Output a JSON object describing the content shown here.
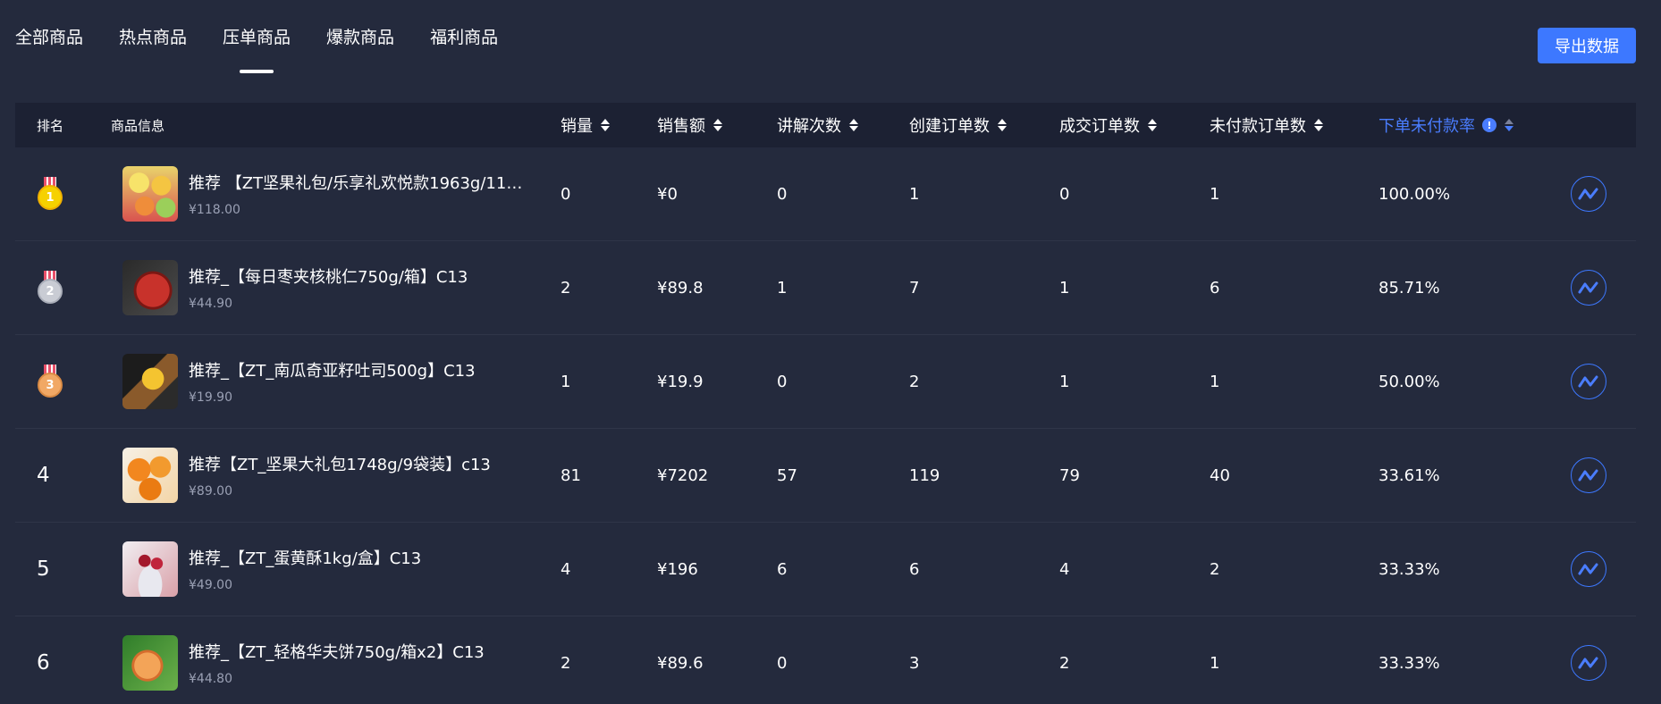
{
  "tabs": [
    {
      "label": "全部商品",
      "active": false
    },
    {
      "label": "热点商品",
      "active": false
    },
    {
      "label": "压单商品",
      "active": true
    },
    {
      "label": "爆款商品",
      "active": false
    },
    {
      "label": "福利商品",
      "active": false
    }
  ],
  "export_button": "导出数据",
  "columns": {
    "rank": "排名",
    "info": "商品信息",
    "sales": "销量",
    "revenue": "销售额",
    "explain_count": "讲解次数",
    "created_orders": "创建订单数",
    "completed_orders": "成交订单数",
    "unpaid_orders": "未付款订单数",
    "unpaid_rate": "下单未付款率",
    "unpaid_rate_info": "!"
  },
  "rows": [
    {
      "rank": "1",
      "medal": "gold",
      "name": "推荐 【ZT坚果礼包/乐享礼欢悦款1963g/11袋...",
      "price": "¥118.00",
      "sales": "0",
      "revenue": "¥0",
      "explain": "0",
      "created": "1",
      "completed": "0",
      "unpaid": "1",
      "rate": "100.00%",
      "thumb": "fruit-slices"
    },
    {
      "rank": "2",
      "medal": "silver",
      "name": "推荐_【每日枣夹核桃仁750g/箱】C13",
      "price": "¥44.90",
      "sales": "2",
      "revenue": "¥89.8",
      "explain": "1",
      "created": "7",
      "completed": "1",
      "unpaid": "6",
      "rate": "85.71%",
      "thumb": "apple"
    },
    {
      "rank": "3",
      "medal": "bronze",
      "name": "推荐_【ZT_南瓜奇亚籽吐司500g】C13",
      "price": "¥19.90",
      "sales": "1",
      "revenue": "¥19.9",
      "explain": "0",
      "created": "2",
      "completed": "1",
      "unpaid": "1",
      "rate": "50.00%",
      "thumb": "banana"
    },
    {
      "rank": "4",
      "medal": "",
      "name": "推荐【ZT_坚果大礼包1748g/9袋装】c13",
      "price": "¥89.00",
      "sales": "81",
      "revenue": "¥7202",
      "explain": "57",
      "created": "119",
      "completed": "79",
      "unpaid": "40",
      "rate": "33.61%",
      "thumb": "oranges"
    },
    {
      "rank": "5",
      "medal": "",
      "name": "推荐_【ZT_蛋黄酥1kg/盒】C13",
      "price": "¥49.00",
      "sales": "4",
      "revenue": "¥196",
      "explain": "6",
      "created": "6",
      "completed": "4",
      "unpaid": "2",
      "rate": "33.33%",
      "thumb": "cherries"
    },
    {
      "rank": "6",
      "medal": "",
      "name": "推荐_【ZT_轻格华夫饼750g/箱x2】C13",
      "price": "¥44.80",
      "sales": "2",
      "revenue": "¥89.6",
      "explain": "0",
      "created": "3",
      "completed": "2",
      "unpaid": "1",
      "rate": "33.33%",
      "thumb": "peaches"
    }
  ],
  "colors": {
    "background": "#242a3d",
    "header_bg": "#1c2133",
    "accent": "#3d78ff",
    "muted_text": "#9aa0b4"
  }
}
